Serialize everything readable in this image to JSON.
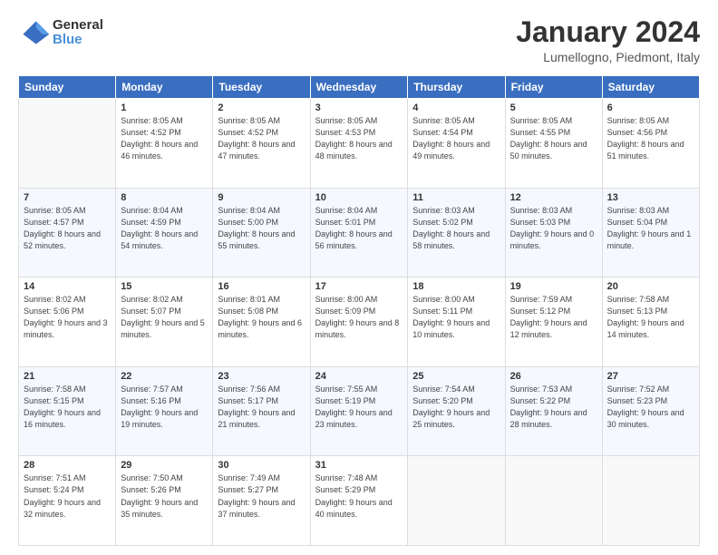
{
  "logo": {
    "general": "General",
    "blue": "Blue"
  },
  "header": {
    "title": "January 2024",
    "location": "Lumellogno, Piedmont, Italy"
  },
  "weekdays": [
    "Sunday",
    "Monday",
    "Tuesday",
    "Wednesday",
    "Thursday",
    "Friday",
    "Saturday"
  ],
  "weeks": [
    [
      {
        "day": "",
        "sunrise": "",
        "sunset": "",
        "daylight": ""
      },
      {
        "day": "1",
        "sunrise": "Sunrise: 8:05 AM",
        "sunset": "Sunset: 4:52 PM",
        "daylight": "Daylight: 8 hours and 46 minutes."
      },
      {
        "day": "2",
        "sunrise": "Sunrise: 8:05 AM",
        "sunset": "Sunset: 4:52 PM",
        "daylight": "Daylight: 8 hours and 47 minutes."
      },
      {
        "day": "3",
        "sunrise": "Sunrise: 8:05 AM",
        "sunset": "Sunset: 4:53 PM",
        "daylight": "Daylight: 8 hours and 48 minutes."
      },
      {
        "day": "4",
        "sunrise": "Sunrise: 8:05 AM",
        "sunset": "Sunset: 4:54 PM",
        "daylight": "Daylight: 8 hours and 49 minutes."
      },
      {
        "day": "5",
        "sunrise": "Sunrise: 8:05 AM",
        "sunset": "Sunset: 4:55 PM",
        "daylight": "Daylight: 8 hours and 50 minutes."
      },
      {
        "day": "6",
        "sunrise": "Sunrise: 8:05 AM",
        "sunset": "Sunset: 4:56 PM",
        "daylight": "Daylight: 8 hours and 51 minutes."
      }
    ],
    [
      {
        "day": "7",
        "sunrise": "Sunrise: 8:05 AM",
        "sunset": "Sunset: 4:57 PM",
        "daylight": "Daylight: 8 hours and 52 minutes."
      },
      {
        "day": "8",
        "sunrise": "Sunrise: 8:04 AM",
        "sunset": "Sunset: 4:59 PM",
        "daylight": "Daylight: 8 hours and 54 minutes."
      },
      {
        "day": "9",
        "sunrise": "Sunrise: 8:04 AM",
        "sunset": "Sunset: 5:00 PM",
        "daylight": "Daylight: 8 hours and 55 minutes."
      },
      {
        "day": "10",
        "sunrise": "Sunrise: 8:04 AM",
        "sunset": "Sunset: 5:01 PM",
        "daylight": "Daylight: 8 hours and 56 minutes."
      },
      {
        "day": "11",
        "sunrise": "Sunrise: 8:03 AM",
        "sunset": "Sunset: 5:02 PM",
        "daylight": "Daylight: 8 hours and 58 minutes."
      },
      {
        "day": "12",
        "sunrise": "Sunrise: 8:03 AM",
        "sunset": "Sunset: 5:03 PM",
        "daylight": "Daylight: 9 hours and 0 minutes."
      },
      {
        "day": "13",
        "sunrise": "Sunrise: 8:03 AM",
        "sunset": "Sunset: 5:04 PM",
        "daylight": "Daylight: 9 hours and 1 minute."
      }
    ],
    [
      {
        "day": "14",
        "sunrise": "Sunrise: 8:02 AM",
        "sunset": "Sunset: 5:06 PM",
        "daylight": "Daylight: 9 hours and 3 minutes."
      },
      {
        "day": "15",
        "sunrise": "Sunrise: 8:02 AM",
        "sunset": "Sunset: 5:07 PM",
        "daylight": "Daylight: 9 hours and 5 minutes."
      },
      {
        "day": "16",
        "sunrise": "Sunrise: 8:01 AM",
        "sunset": "Sunset: 5:08 PM",
        "daylight": "Daylight: 9 hours and 6 minutes."
      },
      {
        "day": "17",
        "sunrise": "Sunrise: 8:00 AM",
        "sunset": "Sunset: 5:09 PM",
        "daylight": "Daylight: 9 hours and 8 minutes."
      },
      {
        "day": "18",
        "sunrise": "Sunrise: 8:00 AM",
        "sunset": "Sunset: 5:11 PM",
        "daylight": "Daylight: 9 hours and 10 minutes."
      },
      {
        "day": "19",
        "sunrise": "Sunrise: 7:59 AM",
        "sunset": "Sunset: 5:12 PM",
        "daylight": "Daylight: 9 hours and 12 minutes."
      },
      {
        "day": "20",
        "sunrise": "Sunrise: 7:58 AM",
        "sunset": "Sunset: 5:13 PM",
        "daylight": "Daylight: 9 hours and 14 minutes."
      }
    ],
    [
      {
        "day": "21",
        "sunrise": "Sunrise: 7:58 AM",
        "sunset": "Sunset: 5:15 PM",
        "daylight": "Daylight: 9 hours and 16 minutes."
      },
      {
        "day": "22",
        "sunrise": "Sunrise: 7:57 AM",
        "sunset": "Sunset: 5:16 PM",
        "daylight": "Daylight: 9 hours and 19 minutes."
      },
      {
        "day": "23",
        "sunrise": "Sunrise: 7:56 AM",
        "sunset": "Sunset: 5:17 PM",
        "daylight": "Daylight: 9 hours and 21 minutes."
      },
      {
        "day": "24",
        "sunrise": "Sunrise: 7:55 AM",
        "sunset": "Sunset: 5:19 PM",
        "daylight": "Daylight: 9 hours and 23 minutes."
      },
      {
        "day": "25",
        "sunrise": "Sunrise: 7:54 AM",
        "sunset": "Sunset: 5:20 PM",
        "daylight": "Daylight: 9 hours and 25 minutes."
      },
      {
        "day": "26",
        "sunrise": "Sunrise: 7:53 AM",
        "sunset": "Sunset: 5:22 PM",
        "daylight": "Daylight: 9 hours and 28 minutes."
      },
      {
        "day": "27",
        "sunrise": "Sunrise: 7:52 AM",
        "sunset": "Sunset: 5:23 PM",
        "daylight": "Daylight: 9 hours and 30 minutes."
      }
    ],
    [
      {
        "day": "28",
        "sunrise": "Sunrise: 7:51 AM",
        "sunset": "Sunset: 5:24 PM",
        "daylight": "Daylight: 9 hours and 32 minutes."
      },
      {
        "day": "29",
        "sunrise": "Sunrise: 7:50 AM",
        "sunset": "Sunset: 5:26 PM",
        "daylight": "Daylight: 9 hours and 35 minutes."
      },
      {
        "day": "30",
        "sunrise": "Sunrise: 7:49 AM",
        "sunset": "Sunset: 5:27 PM",
        "daylight": "Daylight: 9 hours and 37 minutes."
      },
      {
        "day": "31",
        "sunrise": "Sunrise: 7:48 AM",
        "sunset": "Sunset: 5:29 PM",
        "daylight": "Daylight: 9 hours and 40 minutes."
      },
      {
        "day": "",
        "sunrise": "",
        "sunset": "",
        "daylight": ""
      },
      {
        "day": "",
        "sunrise": "",
        "sunset": "",
        "daylight": ""
      },
      {
        "day": "",
        "sunrise": "",
        "sunset": "",
        "daylight": ""
      }
    ]
  ]
}
